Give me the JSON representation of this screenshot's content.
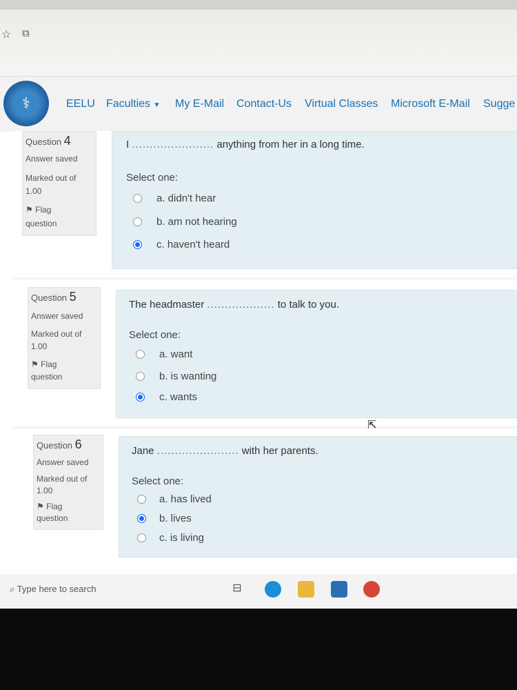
{
  "navbar": {
    "items": [
      "EELU",
      "Faculties",
      "My E-Mail",
      "Contact-Us",
      "Virtual Classes",
      "Microsoft E-Mail",
      "Sugge"
    ]
  },
  "questions": [
    {
      "label": "Question",
      "number": "4",
      "status": "Answer saved",
      "marked_label": "Marked out of",
      "marked_value": "1.00",
      "flag": "Flag",
      "flag_sub": "question",
      "text_before": "I",
      "dots": ".......................",
      "text_after": "anything from her in a long time.",
      "select_label": "Select one:",
      "options": [
        {
          "label": "a. didn't hear",
          "selected": false
        },
        {
          "label": "b. am not hearing",
          "selected": false
        },
        {
          "label": "c. haven't heard",
          "selected": true
        }
      ]
    },
    {
      "label": "Question",
      "number": "5",
      "status": "Answer saved",
      "marked_label": "Marked out of",
      "marked_value": "1.00",
      "flag": "Flag",
      "flag_sub": "question",
      "text_before": "The headmaster",
      "dots": "...................",
      "text_after": "to talk to you.",
      "select_label": "Select one:",
      "options": [
        {
          "label": "a. want",
          "selected": false
        },
        {
          "label": "b. is wanting",
          "selected": false
        },
        {
          "label": "c. wants",
          "selected": true
        }
      ]
    },
    {
      "label": "Question",
      "number": "6",
      "status": "Answer saved",
      "marked_label": "Marked out of",
      "marked_value": "1.00",
      "flag": "Flag",
      "flag_sub": "question",
      "text_before": "Jane",
      "dots": ".......................",
      "text_after": "with her parents.",
      "select_label": "Select one:",
      "options": [
        {
          "label": "a. has lived",
          "selected": false
        },
        {
          "label": "b. lives",
          "selected": true
        },
        {
          "label": "c. is living",
          "selected": false
        }
      ]
    }
  ],
  "taskbar": {
    "search_placeholder": "Type here to search",
    "icons": [
      "task-view-icon",
      "edge-icon",
      "file-explorer-icon",
      "mail-icon",
      "chrome-icon"
    ]
  },
  "colors": {
    "link": "#1b6fae",
    "panel": "#e3eff2",
    "info_box": "#eeeeee",
    "radio_selected": "#1a66ff"
  }
}
